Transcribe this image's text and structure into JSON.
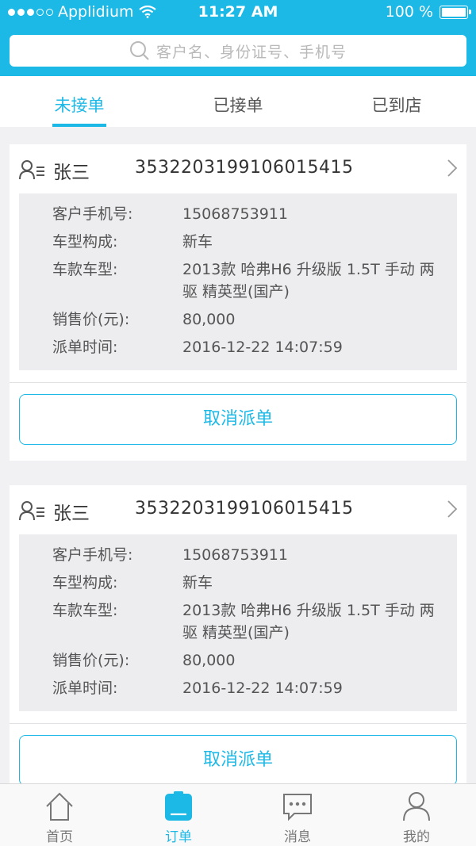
{
  "status_bar": {
    "carrier": "Applidium",
    "time": "11:27 AM",
    "battery": "100 %"
  },
  "search": {
    "placeholder": "客户名、身份证号、手机号"
  },
  "tabs": [
    {
      "label": "未接单",
      "active": true
    },
    {
      "label": "已接单",
      "active": false
    },
    {
      "label": "已到店",
      "active": false
    }
  ],
  "orders": [
    {
      "name": "张三",
      "id_number": "353220319910601541​5",
      "fields": [
        {
          "label": "客户手机号:",
          "value": "15068753911"
        },
        {
          "label": "车型构成:",
          "value": "新车"
        },
        {
          "label": "车款车型:",
          "value": "2013款 哈弗H6 升级版 1.5T 手动 两驱 精英型(国产)"
        },
        {
          "label": "销售价(元):",
          "value": "80,000"
        },
        {
          "label": "派单时间:",
          "value": "2016-12-22 14:07:59"
        }
      ],
      "action": "取消派单"
    },
    {
      "name": "张三",
      "id_number": "353220319910601541​5",
      "fields": [
        {
          "label": "客户手机号:",
          "value": "15068753911"
        },
        {
          "label": "车型构成:",
          "value": "新车"
        },
        {
          "label": "车款车型:",
          "value": "2013款 哈弗H6 升级版 1.5T 手动 两驱 精英型(国产)"
        },
        {
          "label": "销售价(元):",
          "value": "80,000"
        },
        {
          "label": "派单时间:",
          "value": "2016-12-22 14:07:59"
        }
      ],
      "action": "取消派单"
    }
  ],
  "tab_bar": [
    {
      "label": "首页",
      "icon": "home-icon",
      "active": false
    },
    {
      "label": "订单",
      "icon": "order-icon",
      "active": true
    },
    {
      "label": "消息",
      "icon": "message-icon",
      "active": false
    },
    {
      "label": "我的",
      "icon": "profile-icon",
      "active": false
    }
  ],
  "colors": {
    "accent": "#1cb8e6"
  }
}
